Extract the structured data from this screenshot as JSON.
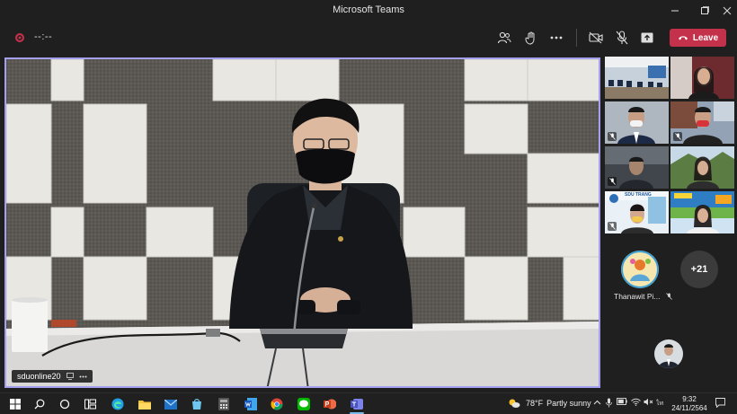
{
  "window": {
    "title": "Microsoft Teams"
  },
  "toolbar": {
    "timer": "--:--",
    "leave_label": "Leave"
  },
  "main_video": {
    "participant_name": "sduonline20"
  },
  "participants": {
    "named_person": "Thanawit Pi...",
    "overflow_count": "+21",
    "thumb_banner_text": "SDU TRANG"
  },
  "taskbar": {
    "weather_temp": "78°F",
    "weather_desc": "Partly sunny",
    "time": "9:32",
    "date": "24/11/2564"
  },
  "colors": {
    "leave_red": "#c4314b",
    "active_border": "#a59ff0",
    "background": "#1f1f1f"
  }
}
